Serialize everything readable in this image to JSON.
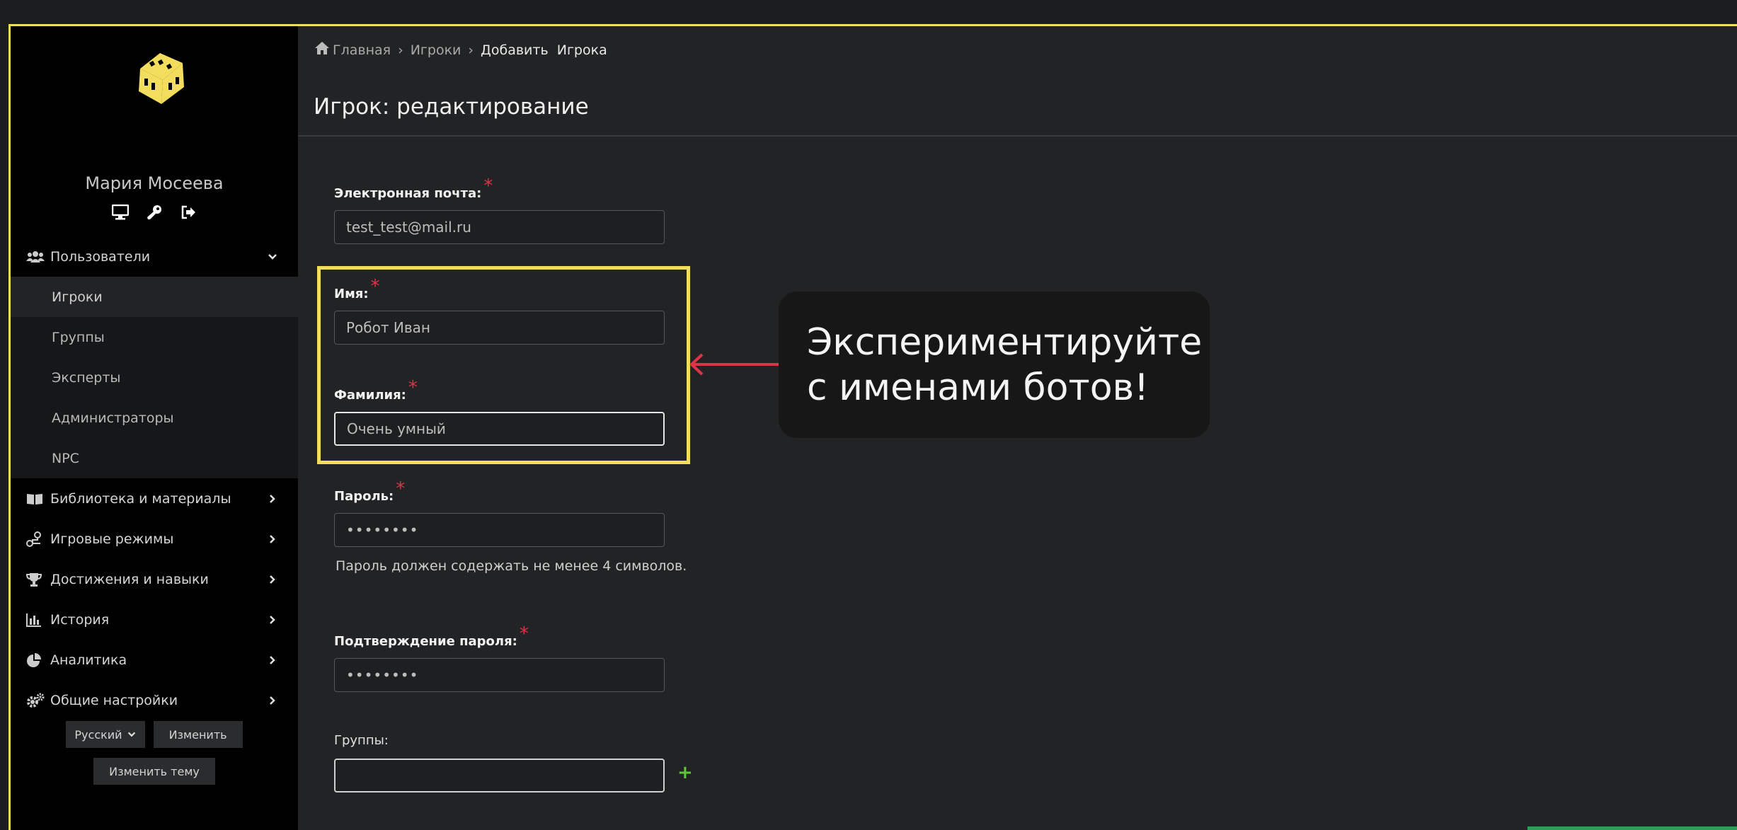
{
  "sidebar": {
    "user_name": "Мария Мосеева",
    "user_icons": [
      "monitor-icon",
      "key-icon",
      "logout-icon"
    ],
    "menu": [
      {
        "label": "Пользователи",
        "icon": "users-icon",
        "expanded": true
      },
      {
        "label": "Библиотека и материалы",
        "icon": "book-icon"
      },
      {
        "label": "Игровые режимы",
        "icon": "route-icon"
      },
      {
        "label": "Достижения и навыки",
        "icon": "trophy-icon"
      },
      {
        "label": "История",
        "icon": "chart-bar-icon"
      },
      {
        "label": "Аналитика",
        "icon": "pie-chart-icon"
      },
      {
        "label": "Общие настройки",
        "icon": "cogs-icon"
      }
    ],
    "submenu": [
      "Игроки",
      "Группы",
      "Эксперты",
      "Администраторы",
      "NPC"
    ],
    "language_select": "Русский",
    "change_button": "Изменить",
    "change_theme_button": "Изменить тему"
  },
  "breadcrumb": {
    "home": "Главная",
    "separator": "›",
    "players": "Игроки",
    "current": "Добавить  Игрока"
  },
  "page_title": "Игрок: редактирование",
  "form": {
    "email": {
      "label": "Электронная почта:",
      "value": "test_test@mail.ru"
    },
    "first_name": {
      "label": "Имя:",
      "value": "Робот Иван"
    },
    "last_name": {
      "label": "Фамилия:",
      "value": "Очень умный"
    },
    "password": {
      "label": "Пароль:",
      "value": "••••••••",
      "hint": "Пароль должен содержать не менее 4 символов."
    },
    "password_confirm": {
      "label": "Подтверждение пароля:",
      "value": "••••••••"
    },
    "groups": {
      "label": "Группы:",
      "value": "",
      "add_symbol": "+"
    },
    "required_mark": "*"
  },
  "callout": {
    "line1": "Экспериментируйте",
    "line2": "с именами ботов!"
  },
  "colors": {
    "highlight": "#f2de5c",
    "required": "#e0334a",
    "arrow": "#e0334a",
    "add": "#5cc83a"
  }
}
